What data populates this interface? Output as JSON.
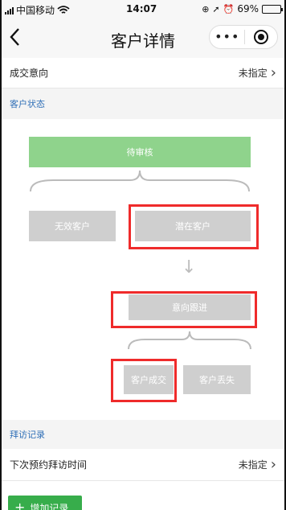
{
  "status_bar": {
    "carrier": "中国移动",
    "time": "14:07",
    "battery": "69%",
    "battery_level": 0.69
  },
  "nav": {
    "title": "客户详情",
    "more_label": "•••"
  },
  "deal_intent_row": {
    "label": "成交意向",
    "value": "未指定"
  },
  "customer_status_section": {
    "title": "客户状态"
  },
  "flow": {
    "pending_review": "待审核",
    "invalid_customer": "无效客户",
    "potential_customer": "潜在客户",
    "intent_follow": "意向跟进",
    "customer_deal": "客户成交",
    "customer_lost": "客户丢失"
  },
  "visit_section": {
    "title": "拜访记录"
  },
  "next_visit_row": {
    "label": "下次预约拜访时间",
    "value": "未指定"
  },
  "add_record_button": {
    "label": "增加记录"
  },
  "colors": {
    "accent_green": "#37ad4b",
    "pending_green": "#8fd38c",
    "highlight_red": "#ef2b2b",
    "section_blue": "#2f6fb7"
  }
}
